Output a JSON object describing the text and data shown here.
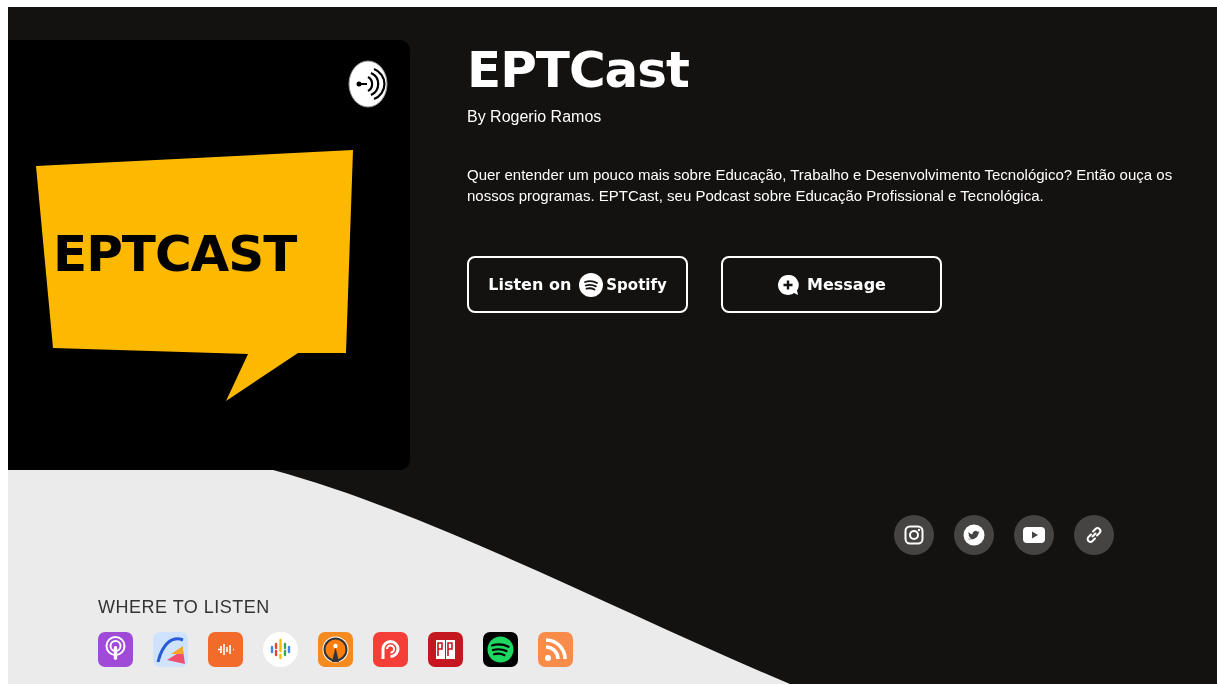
{
  "cover": {
    "logo_text": "EPTCAST"
  },
  "podcast": {
    "title": "EPTCast",
    "author": "By Rogerio Ramos",
    "description": "Quer entender um pouco mais sobre Educação, Trabalho e Desenvolvimento Tecnológico? Então ouça os nossos programas. EPTCast, seu Podcast sobre Educação Profissional e Tecnológica."
  },
  "buttons": [
    {
      "kind": "spotify",
      "label": "Listen on",
      "brand": "Spotify"
    },
    {
      "kind": "message",
      "label": "Message"
    }
  ],
  "where_to_listen": {
    "heading": "WHERE TO LISTEN"
  }
}
